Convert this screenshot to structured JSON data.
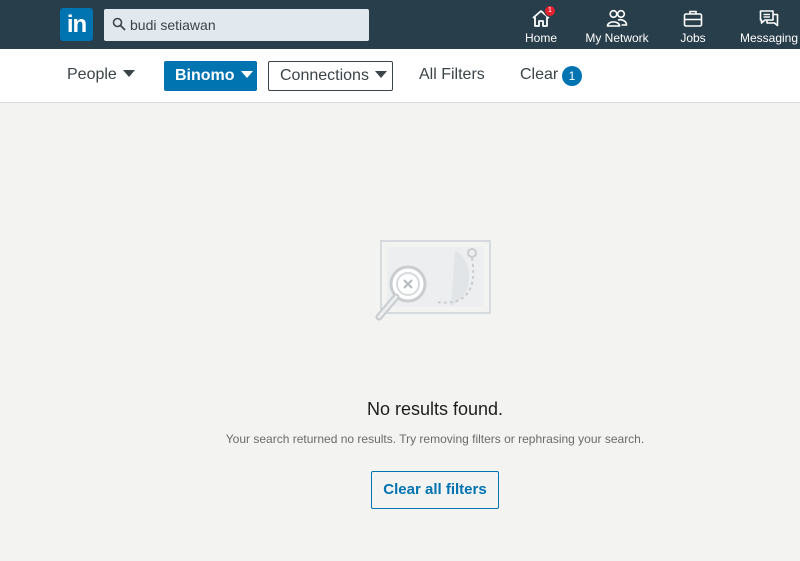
{
  "nav": {
    "logo_text": "in",
    "search": {
      "value": "budi setiawan"
    },
    "items": [
      {
        "label": "Home",
        "icon": "home-icon",
        "badge": "1"
      },
      {
        "label": "My Network",
        "icon": "network-icon"
      },
      {
        "label": "Jobs",
        "icon": "briefcase-icon"
      },
      {
        "label": "Messaging",
        "icon": "messaging-icon"
      }
    ]
  },
  "filters": {
    "people_label": "People",
    "binomo_label": "Binomo",
    "connections_label": "Connections",
    "all_filters_label": "All Filters",
    "clear_label": "Clear",
    "clear_count": "1"
  },
  "empty_state": {
    "title": "No results found.",
    "message": "Your search returned no results. Try removing filters or rephrasing your search.",
    "button_label": "Clear all filters"
  },
  "colors": {
    "nav_bg": "#283e4a",
    "brand_blue": "#0073b1",
    "badge_red": "#e4202f",
    "page_bg": "#f3f3f2"
  }
}
